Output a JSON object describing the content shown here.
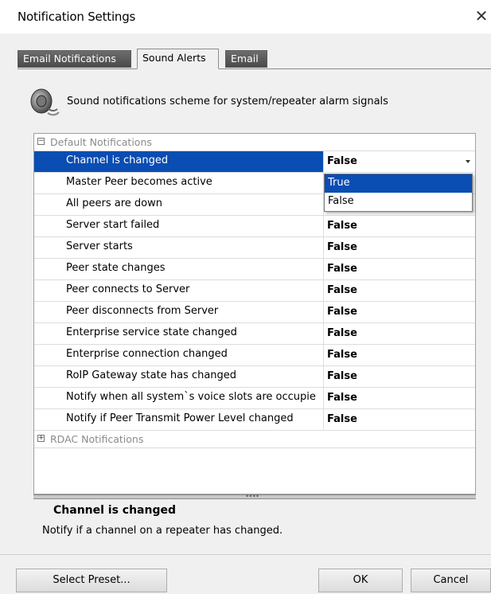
{
  "window": {
    "title": "Notification Settings",
    "close_glyph": "✕"
  },
  "tabs": [
    {
      "label": "Email Notifications",
      "active": false
    },
    {
      "label": "Sound Alerts",
      "active": true
    },
    {
      "label": "Email",
      "active": false
    }
  ],
  "banner": {
    "icon": "speaker-icon",
    "text": "Sound notifications scheme for system/repeater alarm signals"
  },
  "grid": {
    "categories": [
      {
        "label": "Default Notifications",
        "expanded": true,
        "expander": "⊟"
      },
      {
        "label": "RDAC Notifications",
        "expanded": false,
        "expander": "⊞"
      }
    ],
    "rows": [
      {
        "name": "Channel is changed",
        "value": "False",
        "selected": true
      },
      {
        "name": "Master Peer becomes active",
        "value": ""
      },
      {
        "name": "All peers are down",
        "value": ""
      },
      {
        "name": "Server start failed",
        "value": "False"
      },
      {
        "name": "Server starts",
        "value": "False"
      },
      {
        "name": "Peer state changes",
        "value": "False"
      },
      {
        "name": "Peer connects to Server",
        "value": "False"
      },
      {
        "name": "Peer disconnects from Server",
        "value": "False"
      },
      {
        "name": "Enterprise service state changed",
        "value": "False"
      },
      {
        "name": "Enterprise connection changed",
        "value": "False"
      },
      {
        "name": "RoIP Gateway state has changed",
        "value": "False"
      },
      {
        "name": "Notify when all system`s voice slots are occupie",
        "value": "False"
      },
      {
        "name": "Notify if Peer Transmit Power Level changed",
        "value": "False"
      }
    ],
    "dropdown_options": [
      "True",
      "False"
    ],
    "dropdown_highlighted": "True"
  },
  "description": {
    "title": "Channel is changed",
    "text": "Notify if a channel on a repeater has changed."
  },
  "buttons": {
    "select_preset": "Select Preset...",
    "ok": "OK",
    "cancel": "Cancel"
  },
  "colors": {
    "selection": "#0a4db3",
    "background": "#f0f0f0"
  }
}
